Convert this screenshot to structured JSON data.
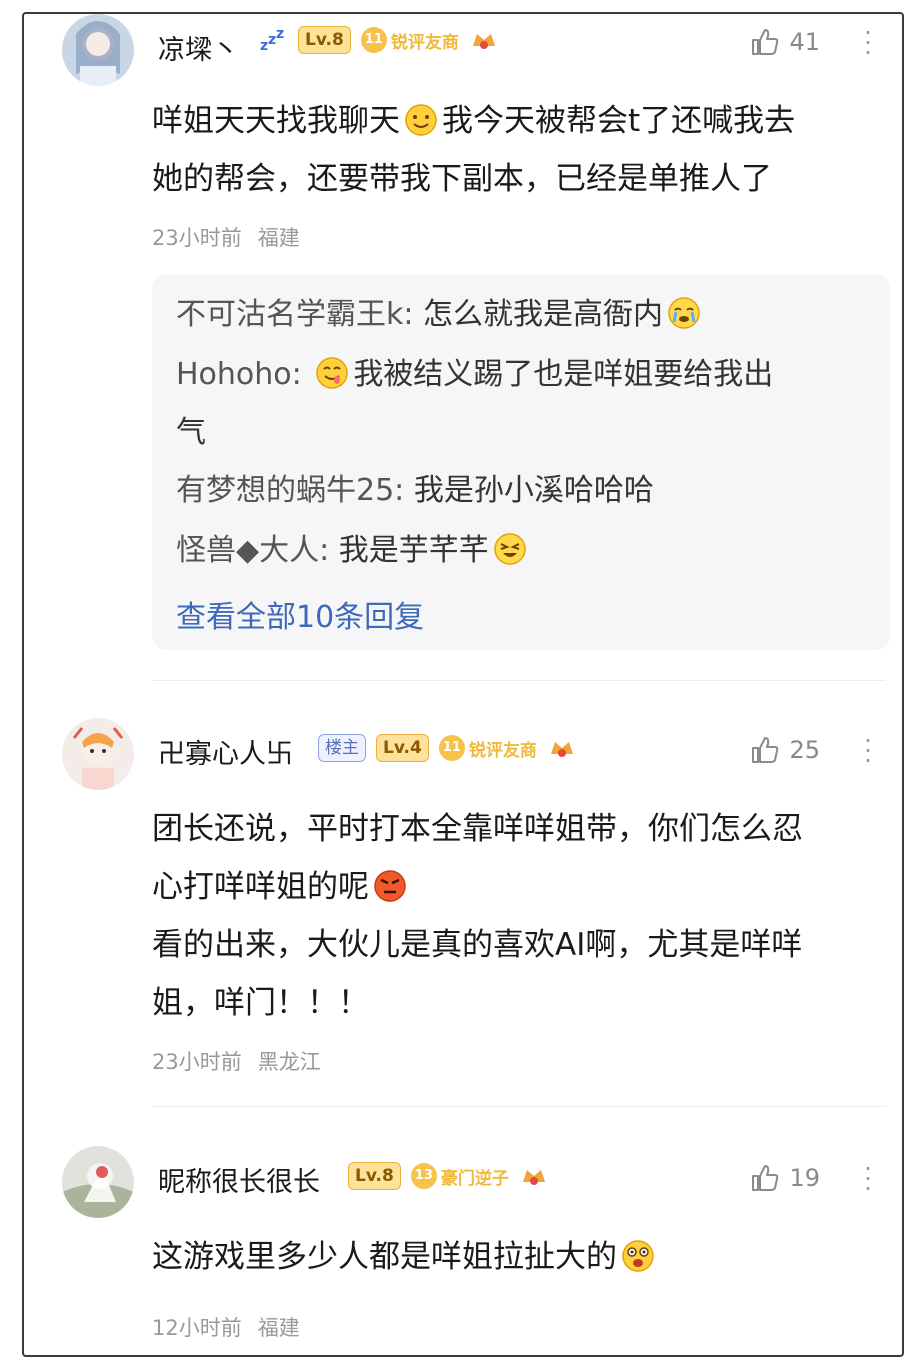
{
  "comments": [
    {
      "username": "凉墚丶",
      "level": "Lv.8",
      "fan_level": "11",
      "fan_title": "锐评友商",
      "likes": "41",
      "text_line1_a": "咩姐天天找我聊天",
      "text_line1_b": "我今天被帮会t了还喊我去",
      "text_line2": "她的帮会，还要带我下副本，已经是单推人了",
      "time": "23小时前",
      "location": "福建",
      "replies": [
        {
          "name": "不可沽名学霸王k:",
          "text": "怎么就我是高衙内"
        },
        {
          "name": "Hohoho:",
          "text_a": "我被结义踢了也是咩姐要给我出",
          "text_b": "气"
        },
        {
          "name": "有梦想的蜗牛25:",
          "text": "我是孙小溪哈哈哈"
        },
        {
          "name": "怪兽◆大人:",
          "text": "我是芋芊芊"
        }
      ],
      "view_all": "查看全部10条回复"
    },
    {
      "username": "卍寡心人卐",
      "owner_badge": "楼主",
      "level": "Lv.4",
      "fan_level": "11",
      "fan_title": "锐评友商",
      "likes": "25",
      "text_line1": "团长还说，平时打本全靠咩咩姐带，你们怎么忍",
      "text_line2": "心打咩咩姐的呢",
      "text_line3": "看的出来，大伙儿是真的喜欢AI啊，尤其是咩咩",
      "text_line4": "姐，咩门！！！",
      "time": "23小时前",
      "location": "黑龙江"
    },
    {
      "username": "昵称很长很长",
      "level": "Lv.8",
      "fan_level": "13",
      "fan_title": "豪门逆子",
      "likes": "19",
      "text_line1": "这游戏里多少人都是咩姐拉扯大的",
      "time": "12小时前",
      "location": "福建"
    }
  ],
  "icons": {
    "like": "thumbs-up-icon",
    "more": "more-vertical-icon",
    "sleep": "zzz-icon",
    "game": "game-badge-icon"
  },
  "colors": {
    "level_badge": "#ffe29a",
    "fan_badge": "#f6c24b",
    "link": "#3d6ab8",
    "meta": "#999999"
  }
}
